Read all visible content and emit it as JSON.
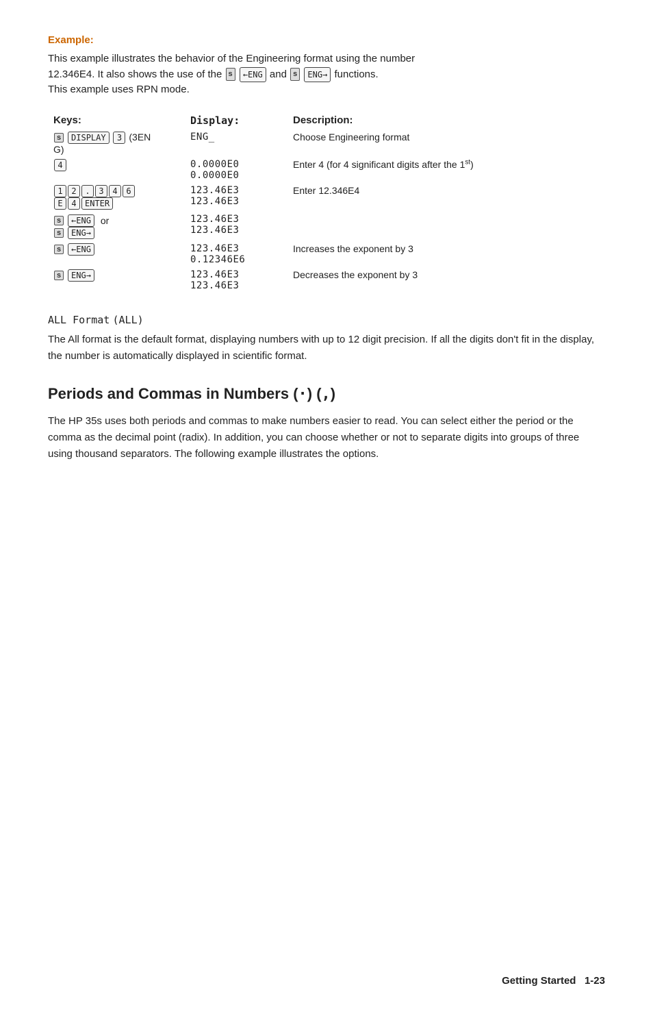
{
  "example": {
    "label": "Example:",
    "intro_line1": "This example illustrates the behavior of the Engineering format using the number",
    "intro_line2": "12.346E4. It also shows the use of the",
    "intro_line2_and": "and",
    "intro_line2_end": "functions.",
    "intro_line3": "This example uses RPN mode."
  },
  "table": {
    "headers": {
      "keys": "Keys:",
      "display": "Display:",
      "description": "Description:"
    },
    "rows": [
      {
        "keys_text": "DISPLAY 3 (3EN G)",
        "display1": "ENG_",
        "display2": "",
        "description": "Choose Engineering format"
      },
      {
        "keys_text": "4",
        "display1": "0.0000E0",
        "display2": "0.0000E0",
        "description": "Enter 4 (for 4 significant digits after the 1st)"
      },
      {
        "keys_text": "1 2 . 3 4 6 E 4 ENTER",
        "display1": "123.46E3",
        "display2": "123.46E3",
        "description": "Enter 12.346E4"
      },
      {
        "keys_text": "←ENG or ENG→",
        "display1": "123.46E3",
        "display2": "123.46E3",
        "description": ""
      },
      {
        "keys_text": "←ENG",
        "display1": "123.46E3",
        "display2": "0.12346E6",
        "description": "Increases the exponent by 3"
      },
      {
        "keys_text": "ENG→",
        "display1": "123.46E3",
        "display2": "123.46E3",
        "description": "Decreases the exponent by 3"
      }
    ]
  },
  "all_format": {
    "label": "ALL Format",
    "code": "(ALL)",
    "text": "The All format is the default format, displaying numbers with up to 12 digit precision. If all the digits don't fit in the display, the number is automatically displayed in scientific format."
  },
  "section": {
    "heading": "Periods and Commas in Numbers (.) (,)",
    "text": "The HP 35s uses both periods and commas to make numbers easier to read.  You can select either the period or the comma as the decimal point (radix). In addition, you can choose whether or not to separate digits into groups of three using thousand separators. The following example illustrates the options."
  },
  "footer": {
    "text": "Getting Started",
    "page": "1-23"
  }
}
